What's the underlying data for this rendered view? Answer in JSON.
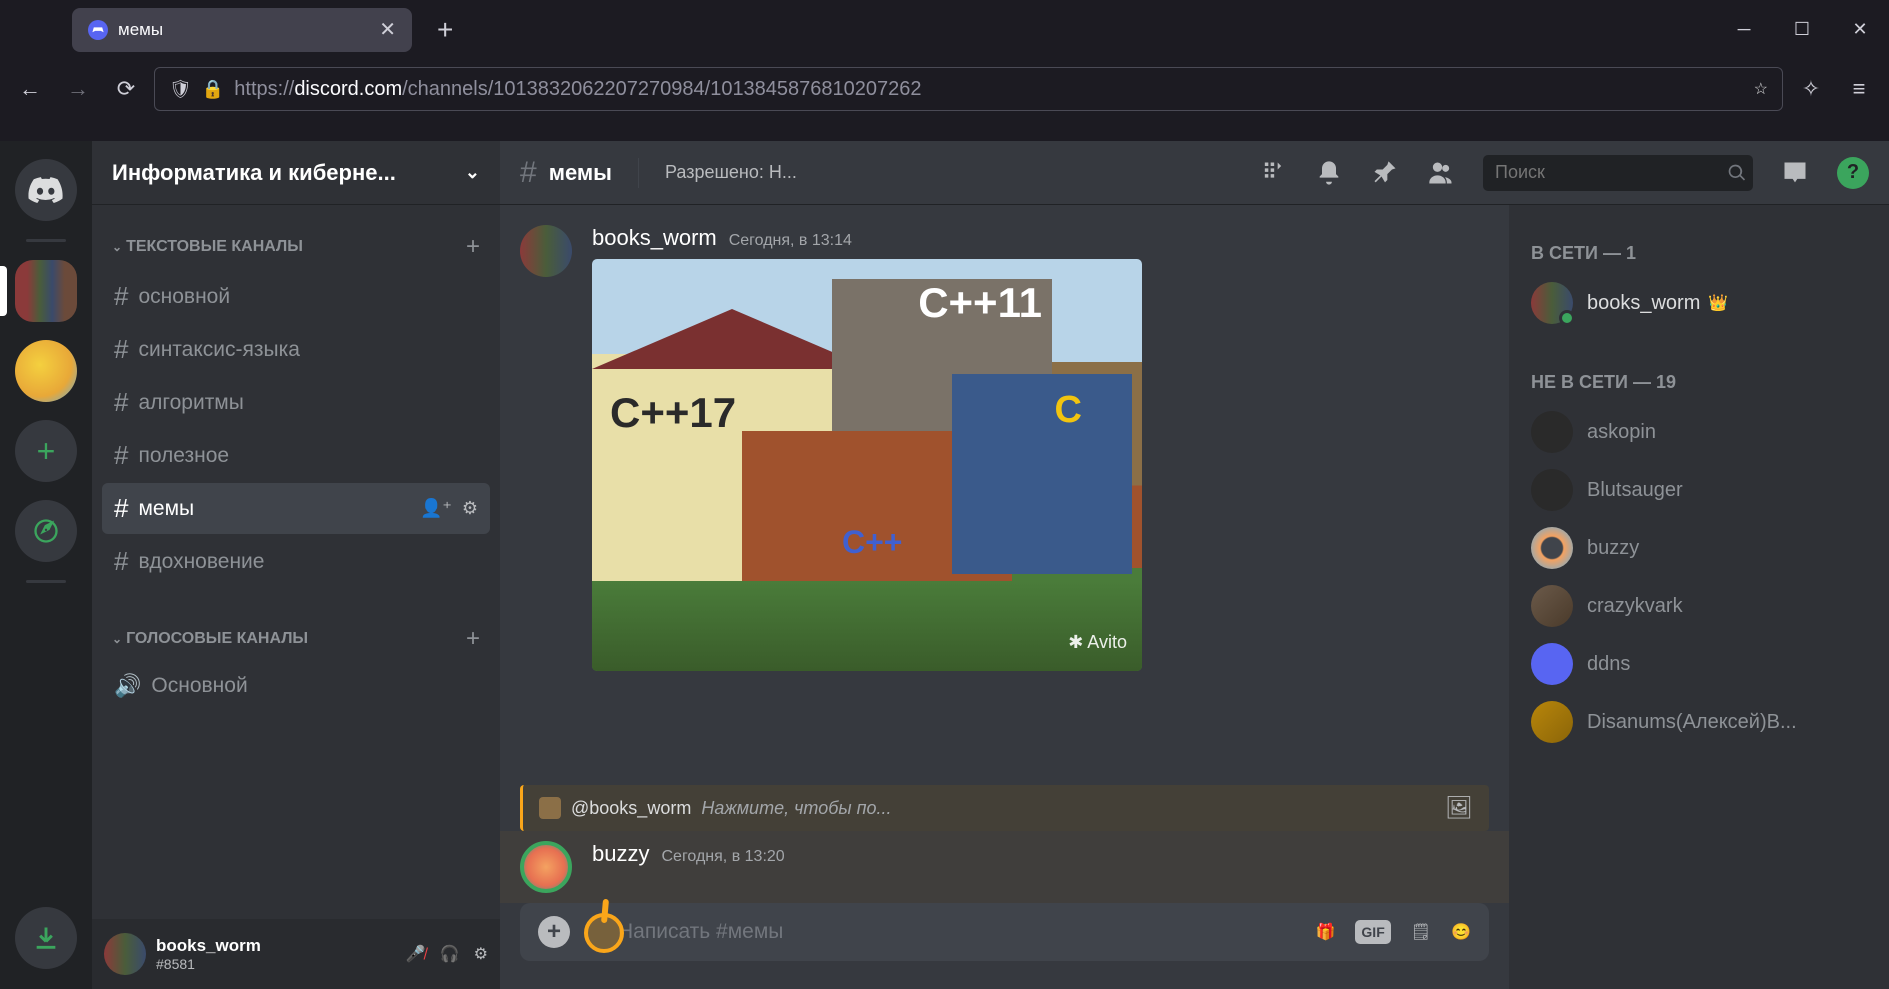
{
  "browser": {
    "tab_title": "мемы",
    "url_protocol": "https://",
    "url_host": "discord.com",
    "url_path": "/channels/1013832062207270984/1013845876810207262"
  },
  "server": {
    "name": "Информатика и киберне..."
  },
  "channel_categories": [
    {
      "label": "ТЕКСТОВЫЕ КАНАЛЫ",
      "channels": [
        {
          "name": "основной",
          "type": "text",
          "active": false
        },
        {
          "name": "синтаксис-языка",
          "type": "text",
          "active": false
        },
        {
          "name": "алгоритмы",
          "type": "text",
          "active": false
        },
        {
          "name": "полезное",
          "type": "text",
          "active": false
        },
        {
          "name": "мемы",
          "type": "text",
          "active": true
        },
        {
          "name": "вдохновение",
          "type": "text",
          "active": false
        }
      ]
    },
    {
      "label": "ГОЛОСОВЫЕ КАНАЛЫ",
      "channels": [
        {
          "name": "Основной",
          "type": "voice",
          "active": false
        }
      ]
    }
  ],
  "current_user": {
    "name": "books_worm",
    "tag": "#8581"
  },
  "chat": {
    "channel_name": "мемы",
    "topic": "Разрешено: Н...",
    "search_placeholder": "Поиск",
    "input_placeholder": "Написать #мемы"
  },
  "messages": [
    {
      "author": "books_worm",
      "timestamp": "Сегодня, в 13:14",
      "image_labels": {
        "c11": "C++11",
        "c17": "C++17",
        "c": "C",
        "cpp": "C++",
        "watermark": "Avito"
      }
    },
    {
      "type": "reply_ref",
      "mention": "@books_worm",
      "hint": "Нажмите, чтобы по..."
    },
    {
      "author": "buzzy",
      "timestamp": "Сегодня, в 13:20"
    }
  ],
  "members": {
    "online_label": "В СЕТИ — 1",
    "offline_label": "НЕ В СЕТИ — 19",
    "online": [
      {
        "name": "books_worm",
        "owner": true
      }
    ],
    "offline": [
      {
        "name": "askopin"
      },
      {
        "name": "Blutsauger"
      },
      {
        "name": "buzzy"
      },
      {
        "name": "crazykvark"
      },
      {
        "name": "ddns"
      },
      {
        "name": "Disanums(Алексей)В..."
      }
    ]
  }
}
